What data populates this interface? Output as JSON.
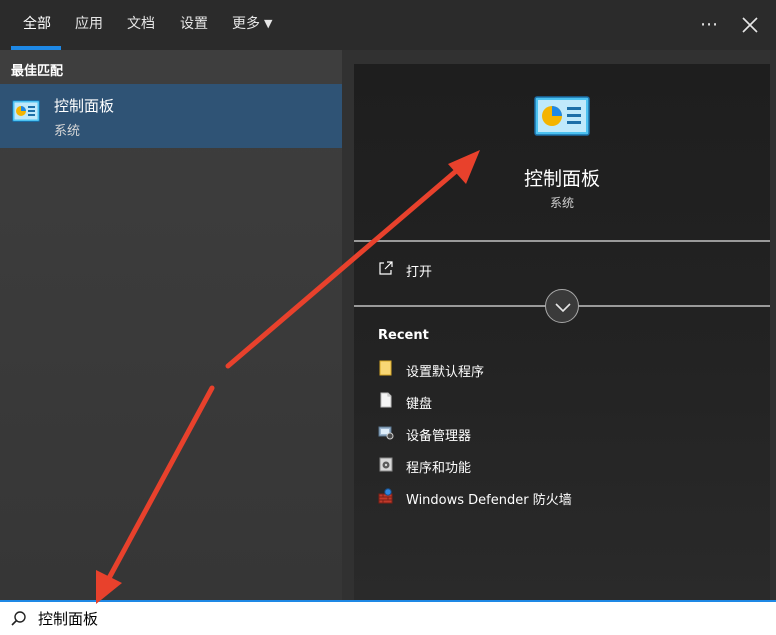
{
  "tabs": [
    {
      "label": "全部",
      "active": true
    },
    {
      "label": "应用",
      "active": false
    },
    {
      "label": "文档",
      "active": false
    },
    {
      "label": "设置",
      "active": false
    },
    {
      "label": "更多",
      "active": false
    }
  ],
  "top_icons": {
    "more": "more-options-icon",
    "close": "close-icon"
  },
  "left": {
    "section_title": "最佳匹配",
    "best_match": {
      "title": "控制面板",
      "subtitle": "系统",
      "icon": "control-panel-icon"
    }
  },
  "right": {
    "title": "控制面板",
    "subtitle": "系统",
    "open_label": "打开",
    "recent_title": "Recent",
    "recent": [
      {
        "label": "设置默认程序",
        "icon": "folder-icon"
      },
      {
        "label": "键盘",
        "icon": "document-icon"
      },
      {
        "label": "设备管理器",
        "icon": "device-manager-icon"
      },
      {
        "label": "程序和功能",
        "icon": "programs-icon"
      },
      {
        "label": "Windows Defender 防火墙",
        "icon": "firewall-icon"
      }
    ]
  },
  "search": {
    "value": "控制面板",
    "icon": "search-icon"
  },
  "colors": {
    "accent": "#1e88e5",
    "selection": "#2f5375",
    "annotation_arrow": "#e8412c"
  }
}
